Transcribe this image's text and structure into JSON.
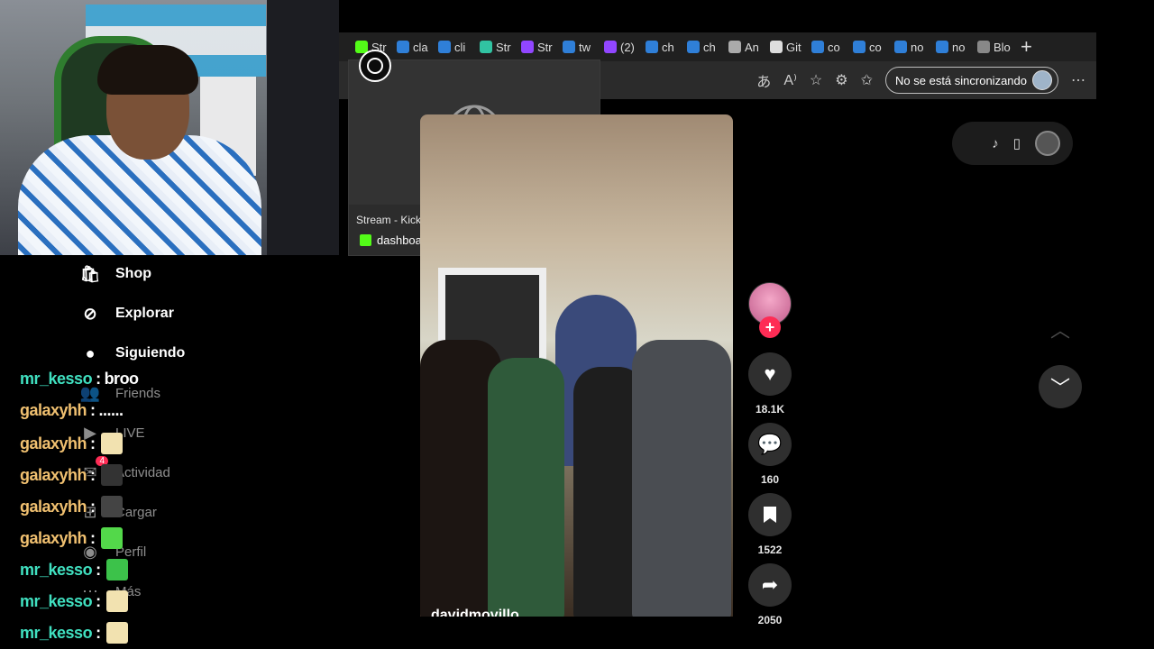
{
  "browser": {
    "tabs": [
      {
        "label": "Str",
        "icon": "kick-icon",
        "color": "#53fc18"
      },
      {
        "label": "cla",
        "icon": "bing-icon",
        "color": "#2f7fd8"
      },
      {
        "label": "cli",
        "icon": "bing-icon",
        "color": "#2f7fd8"
      },
      {
        "label": "Str",
        "icon": "streamlabs-icon",
        "color": "#31c3a2"
      },
      {
        "label": "Str",
        "icon": "twitch-icon",
        "color": "#9146ff"
      },
      {
        "label": "tw",
        "icon": "bing-icon",
        "color": "#2f7fd8"
      },
      {
        "label": "(2)",
        "icon": "twitch-icon",
        "color": "#9146ff"
      },
      {
        "label": "ch",
        "icon": "search-icon",
        "color": "#2f7fd8"
      },
      {
        "label": "ch",
        "icon": "search-icon",
        "color": "#2f7fd8"
      },
      {
        "label": "An",
        "icon": "amazon-icon",
        "color": "#aaaaaa"
      },
      {
        "label": "Git",
        "icon": "github-icon",
        "color": "#dddddd"
      },
      {
        "label": "co",
        "icon": "bing-icon",
        "color": "#2f7fd8"
      },
      {
        "label": "co",
        "icon": "search-icon",
        "color": "#2f7fd8"
      },
      {
        "label": "no",
        "icon": "bing-icon",
        "color": "#2f7fd8"
      },
      {
        "label": "no",
        "icon": "bing-icon",
        "color": "#2f7fd8"
      },
      {
        "label": "Blo",
        "icon": "page-icon",
        "color": "#888888"
      }
    ],
    "new_tab": "+",
    "sync_label": "No se está sincronizando",
    "preview": {
      "title": "Stream - Kick Dashboard",
      "url": "dashboard.kick.com"
    }
  },
  "sidebar": {
    "items": [
      {
        "label": "Shop",
        "icon": "shop-bag-icon"
      },
      {
        "label": "Explorar",
        "icon": "compass-icon"
      },
      {
        "label": "Siguiendo",
        "icon": "avatar-icon"
      },
      {
        "label": "Friends",
        "icon": "friends-icon"
      },
      {
        "label": "LIVE",
        "icon": "live-icon"
      },
      {
        "label": "Actividad",
        "icon": "activity-icon",
        "badge": "4"
      },
      {
        "label": "Cargar",
        "icon": "upload-icon"
      },
      {
        "label": "Perfil",
        "icon": "profile-icon"
      },
      {
        "label": "Más",
        "icon": "more-icon"
      }
    ]
  },
  "chat": [
    {
      "user": "mr_kesso",
      "sep": ":",
      "msg": "broo",
      "color": "teal"
    },
    {
      "user": "galaxyhh",
      "sep": ":",
      "msg": "......",
      "color": "gold"
    },
    {
      "user": "galaxyhh",
      "sep": ":",
      "msg": "",
      "emote": "#f2e2b0",
      "color": "gold"
    },
    {
      "user": "galaxyhh",
      "sep": ":",
      "msg": "",
      "emote": "#333333",
      "color": "gold"
    },
    {
      "user": "galaxyhh",
      "sep": ":",
      "msg": "",
      "emote": "#444444",
      "color": "gold"
    },
    {
      "user": "galaxyhh",
      "sep": ":",
      "msg": "",
      "emote": "#53d84a",
      "color": "gold"
    },
    {
      "user": "mr_kesso",
      "sep": ":",
      "msg": "",
      "emote": "#3cc24a",
      "color": "teal"
    },
    {
      "user": "mr_kesso",
      "sep": ":",
      "msg": "",
      "emote": "#f2e2b0",
      "color": "teal"
    },
    {
      "user": "mr_kesso",
      "sep": ":",
      "msg": "",
      "emote": "#f2e2b0",
      "color": "teal"
    }
  ],
  "video": {
    "author": "davidmovillo",
    "likes": "18.1K",
    "comments": "160",
    "saves": "1522",
    "shares": "2050"
  },
  "colors": {
    "kick_green": "#53fc18",
    "tiktok_red": "#fe2c55"
  }
}
